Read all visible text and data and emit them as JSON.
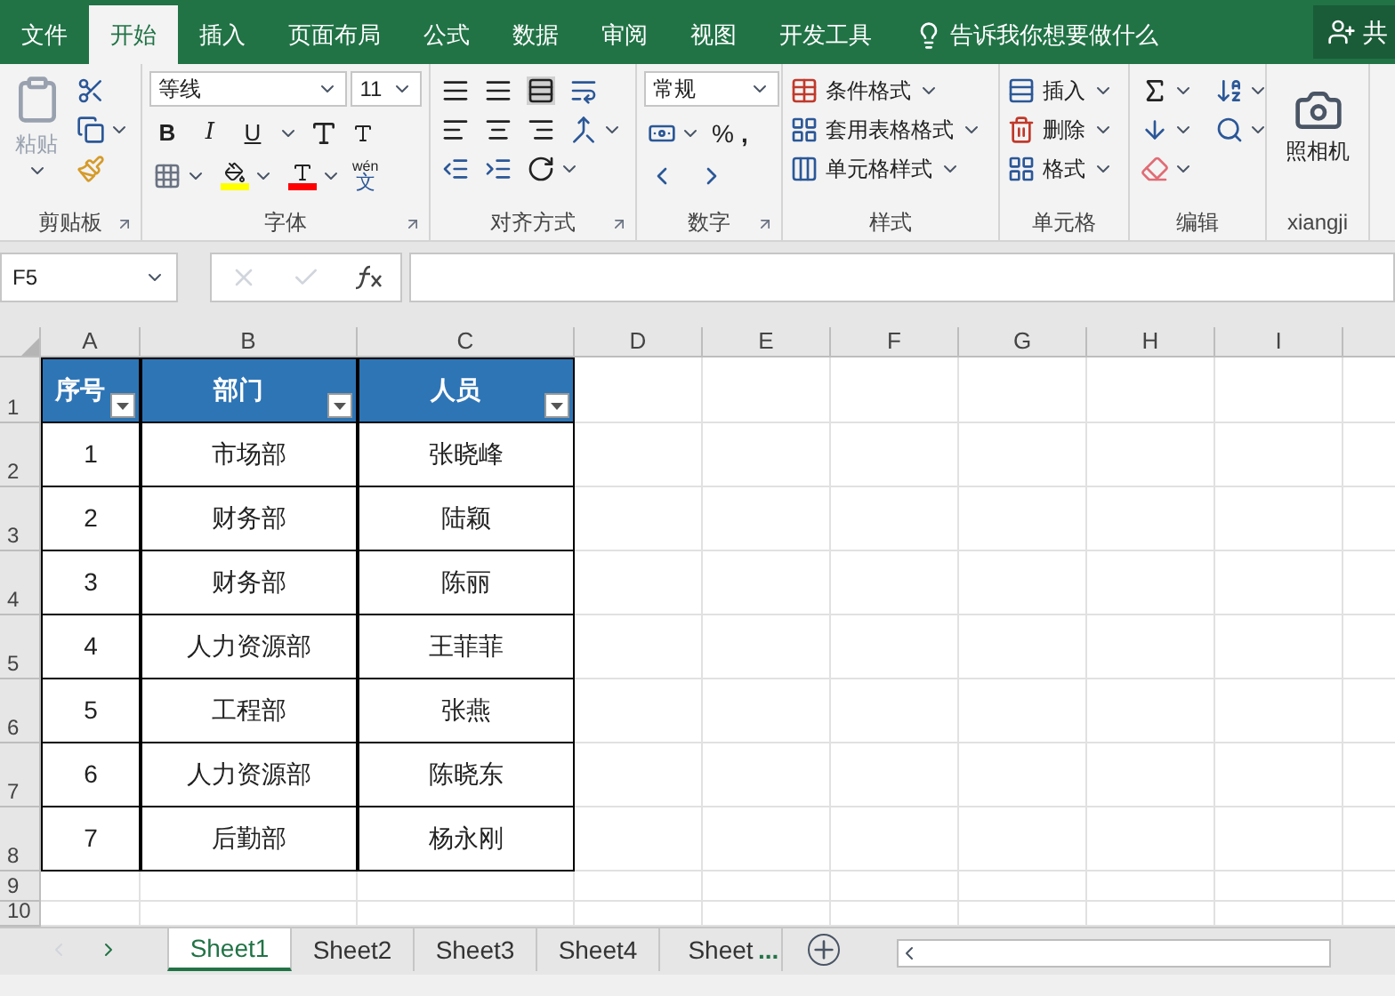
{
  "tabs": [
    {
      "label": "文件",
      "selected": false
    },
    {
      "label": "开始",
      "selected": true
    },
    {
      "label": "插入",
      "selected": false
    },
    {
      "label": "页面布局",
      "selected": false
    },
    {
      "label": "公式",
      "selected": false
    },
    {
      "label": "数据",
      "selected": false
    },
    {
      "label": "审阅",
      "selected": false
    },
    {
      "label": "视图",
      "selected": false
    },
    {
      "label": "开发工具",
      "selected": false
    }
  ],
  "tell_me": "告诉我你想要做什么",
  "share": "共",
  "ribbon": {
    "clipboard": {
      "label": "剪贴板",
      "paste": "粘贴",
      "launcher": true
    },
    "font": {
      "label": "字体",
      "face": "等线",
      "size": "11",
      "bold": "B",
      "italic": "I",
      "underline": "U",
      "phonetic": "wén",
      "phonetic_char": "文",
      "launcher": true
    },
    "alignment": {
      "label": "对齐方式",
      "launcher": true
    },
    "number": {
      "label": "数字",
      "format": "常规",
      "percent": "%",
      "comma": ",",
      "launcher": true
    },
    "styles": {
      "label": "样式",
      "buttons": [
        "条件格式",
        "套用表格格式",
        "单元格样式"
      ]
    },
    "cells": {
      "label": "单元格",
      "buttons": [
        "插入",
        "删除",
        "格式"
      ]
    },
    "editing": {
      "label": "编辑"
    },
    "camera": {
      "label": "xiangji",
      "button": "照相机"
    }
  },
  "name_box": "F5",
  "columns": [
    "A",
    "B",
    "C",
    "D",
    "E",
    "F",
    "G",
    "H",
    "I"
  ],
  "table": {
    "headers": [
      "序号",
      "部门",
      "人员"
    ],
    "rows": [
      [
        "1",
        "市场部",
        "张晓峰"
      ],
      [
        "2",
        "财务部",
        "陆颖"
      ],
      [
        "3",
        "财务部",
        "陈丽"
      ],
      [
        "4",
        "人力资源部",
        "王菲菲"
      ],
      [
        "5",
        "工程部",
        "张燕"
      ],
      [
        "6",
        "人力资源部",
        "陈晓东"
      ],
      [
        "7",
        "后勤部",
        "杨永刚"
      ]
    ]
  },
  "row_numbers": [
    "1",
    "2",
    "3",
    "4",
    "5",
    "6",
    "7",
    "8",
    "9",
    "10"
  ],
  "sheets": [
    {
      "label": "Sheet1",
      "selected": true
    },
    {
      "label": "Sheet2",
      "selected": false
    },
    {
      "label": "Sheet3",
      "selected": false
    },
    {
      "label": "Sheet4",
      "selected": false
    },
    {
      "label": "Sheet",
      "selected": false
    }
  ],
  "more_sheets": "..."
}
